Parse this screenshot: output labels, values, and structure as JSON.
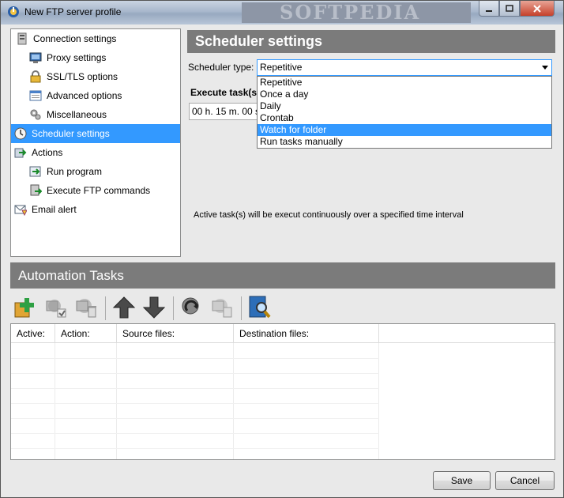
{
  "window": {
    "title": "New FTP server profile",
    "watermark": "SOFTPEDIA"
  },
  "tree": {
    "items": [
      {
        "label": "Connection settings",
        "icon": "server-icon"
      },
      {
        "label": "Proxy settings",
        "icon": "proxy-icon"
      },
      {
        "label": "SSL/TLS options",
        "icon": "lock-icon"
      },
      {
        "label": "Advanced options",
        "icon": "window-icon"
      },
      {
        "label": "Miscellaneous",
        "icon": "gears-icon"
      },
      {
        "label": "Scheduler settings",
        "icon": "clock-icon"
      },
      {
        "label": "Actions",
        "icon": "actions-icon"
      },
      {
        "label": "Run program",
        "icon": "run-icon"
      },
      {
        "label": "Execute FTP commands",
        "icon": "ftp-commands-icon"
      },
      {
        "label": "Email alert",
        "icon": "email-alert-icon"
      }
    ],
    "selected": "Scheduler settings"
  },
  "scheduler": {
    "header": "Scheduler settings",
    "type_label": "Scheduler type:",
    "selected": "Repetitive",
    "options": [
      "Repetitive",
      "Once a day",
      "Daily",
      "Crontab",
      "Watch for folder",
      "Run tasks manually"
    ],
    "highlighted": "Watch for folder",
    "execute_label": "Execute task(s)",
    "execute_value": "00 h. 15 m. 00 s.",
    "note": "Active task(s) will be execut continuously over a specified time interval"
  },
  "automation": {
    "header": "Automation Tasks",
    "toolbar": [
      "add-task-icon",
      "edit-task-icon",
      "delete-task-icon",
      "move-up-icon",
      "move-down-icon",
      "refresh-icon",
      "duplicate-icon",
      "search-icon"
    ],
    "columns": [
      "Active:",
      "Action:",
      "Source files:",
      "Destination files:"
    ]
  },
  "buttons": {
    "save": "Save",
    "cancel": "Cancel"
  },
  "colors": {
    "selection": "#3399ff",
    "header_gray": "#7b7b7b"
  }
}
